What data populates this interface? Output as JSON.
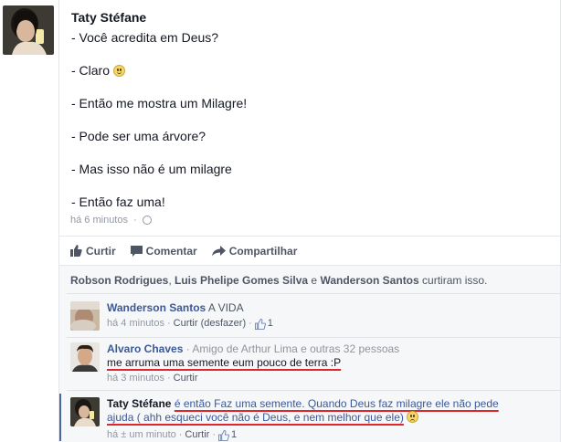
{
  "post": {
    "author": "Taty Stéfane",
    "lines": [
      "- Você acredita em Deus?",
      "- Claro",
      "- Então me mostra um Milagre!",
      "- Pode ser uma árvore?",
      "- Mas isso não é um milagre",
      "- Então faz uma!"
    ],
    "timestamp": "há 6 minutos",
    "icons": {
      "claro_emoji": "smile-emoji",
      "privacy": "globe-icon"
    }
  },
  "actions": {
    "like": "Curtir",
    "comment": "Comentar",
    "share": "Compartilhar"
  },
  "likes": {
    "name1": "Robson Rodrigues",
    "name2": "Luis Phelipe Gomes Silva",
    "conj": "e",
    "name3": "Wanderson Santos",
    "suffix": "curtiram isso."
  },
  "comments": [
    {
      "author": "Wanderson Santos",
      "text": "A VIDA",
      "time": "há 4 minutos",
      "dot": "·",
      "action": "Curtir (desfazer)",
      "likes": "1"
    },
    {
      "author": "Alvaro Chaves",
      "subtitle": "· Amigo de Arthur Lima e outras 32 pessoas",
      "text": "me arruma uma semente eum pouco de terra :P",
      "time": "há 3 minutos",
      "dot": "·",
      "action": "Curtir"
    },
    {
      "author": "Taty Stéfane",
      "text_line1": "é então Faz uma semente. Quando Deus faz milagre ele não pede",
      "text_line2": "ajuda ( ahh esqueci você não é Deus, e nem melhor que ele)",
      "time": "há ± um minuto",
      "dot": "·",
      "action": "Curtir",
      "likes": "1"
    }
  ],
  "colors": {
    "link_blue": "#3b5998",
    "underline_red": "#e0262c",
    "meta_gray": "#9197a3"
  }
}
